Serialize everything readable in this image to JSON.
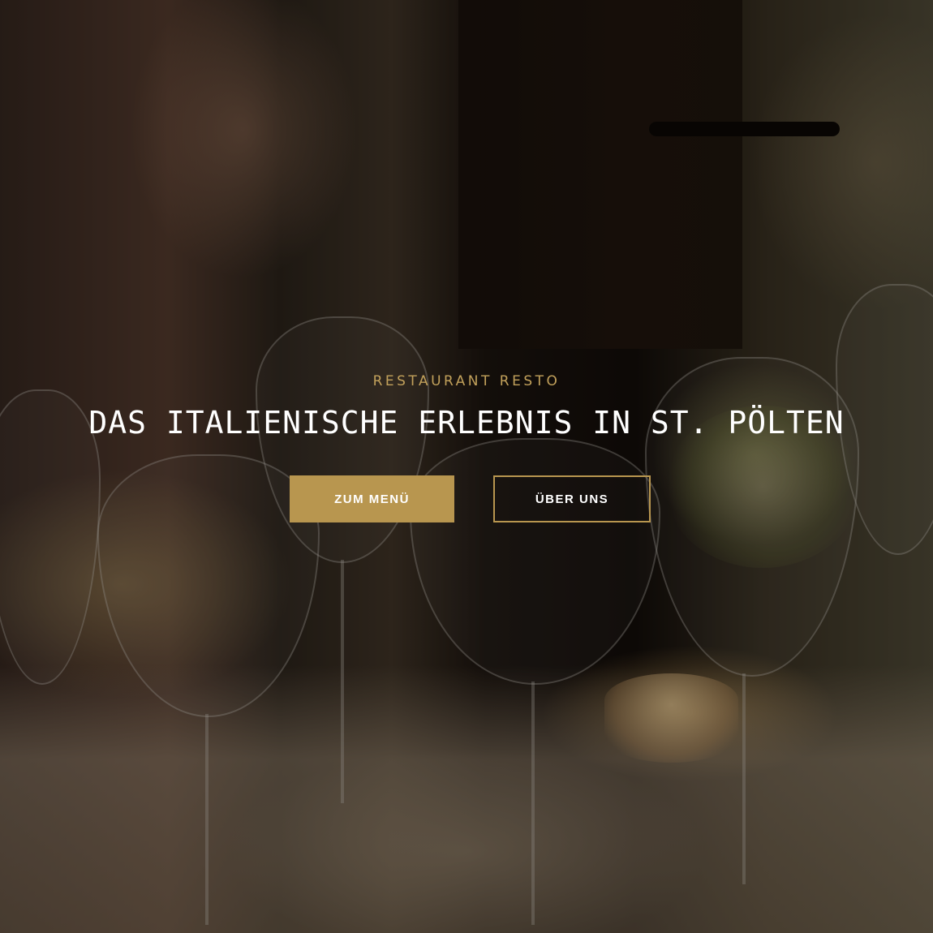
{
  "hero": {
    "eyebrow": "RESTAURANT RESTO",
    "title": "DAS ITALIENISCHE ERLEBNIS IN ST. PÖLTEN",
    "primary_button_label": "ZUM MENÜ",
    "secondary_button_label": "ÜBER UNS"
  },
  "colors": {
    "accent": "#b8964f",
    "eyebrow": "#c2a15b",
    "title": "#ffffff"
  },
  "background": {
    "image": "restaurant-table-wine-glasses"
  }
}
